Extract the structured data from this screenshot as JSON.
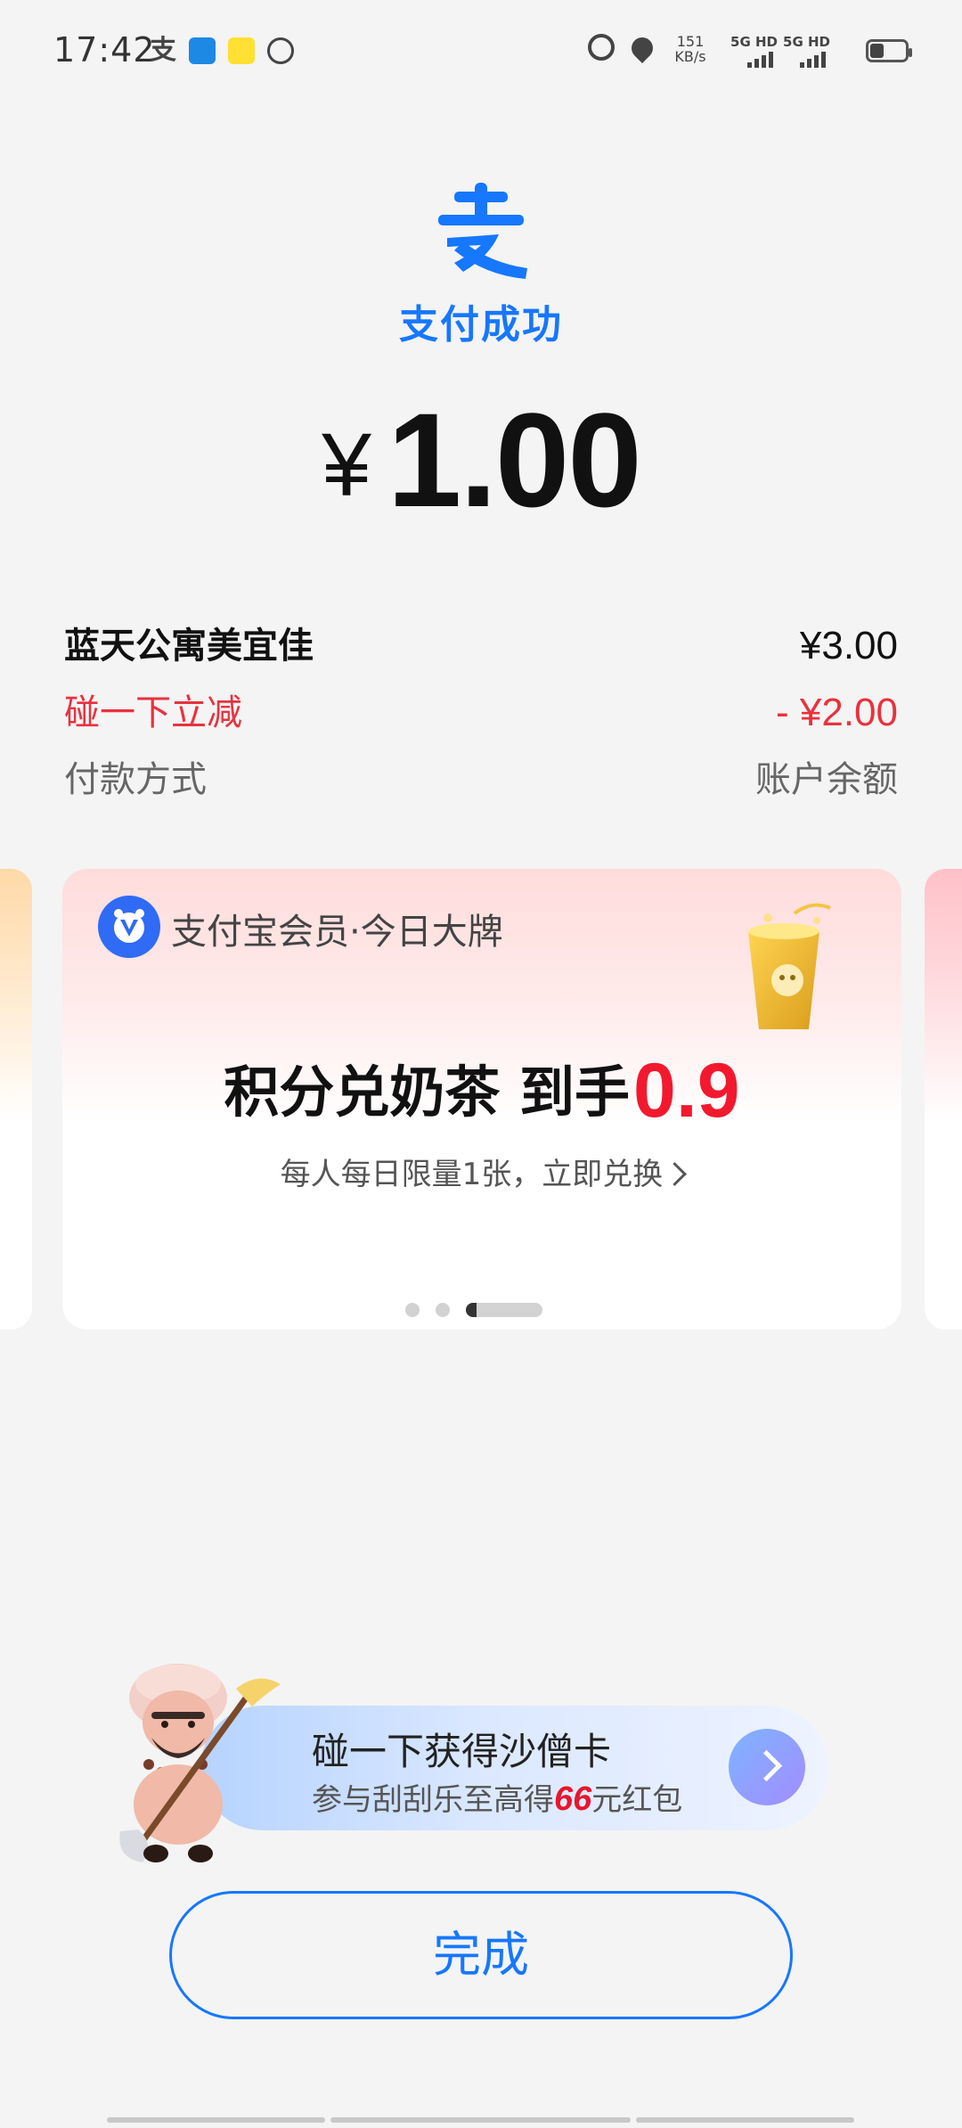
{
  "status_bar": {
    "time": "17:42",
    "alipay_glyph": "支",
    "net_speed_value": "151",
    "net_speed_unit": "KB/s",
    "signal1_label": "5G HD",
    "signal2_label": "5G HD",
    "icons": [
      "alipay-icon",
      "ticket-app-icon",
      "meitu-app-icon",
      "ring-app-icon",
      "alarm-icon",
      "location-icon",
      "signal-icon",
      "battery-icon"
    ]
  },
  "header": {
    "logo_glyph": "支",
    "status_title": "支付成功"
  },
  "amount": {
    "currency": "¥",
    "value": "1.00"
  },
  "details": {
    "merchant_label": "蓝天公寓美宜佳",
    "merchant_amount": "¥3.00",
    "discount_label": "碰一下立减",
    "discount_amount": "- ¥2.00",
    "method_label": "付款方式",
    "method_value": "账户余额"
  },
  "promo": {
    "brand": "支付宝会员·今日大牌",
    "headline": "积分兑奶茶 到手",
    "price": "0.9",
    "subtext": "每人每日限量1张，立即兑换",
    "carousel_total": 3,
    "carousel_active": 3
  },
  "banner": {
    "title": "碰一下获得沙僧卡",
    "sub_prefix": "参与刮刮乐至高得",
    "sub_highlight": "66",
    "sub_suffix": "元红包"
  },
  "actions": {
    "done_label": "完成"
  },
  "colors": {
    "brand_blue": "#1677ff",
    "discount_red": "#e8323e",
    "price_red": "#f2192e",
    "page_bg": "#f4f4f4"
  }
}
